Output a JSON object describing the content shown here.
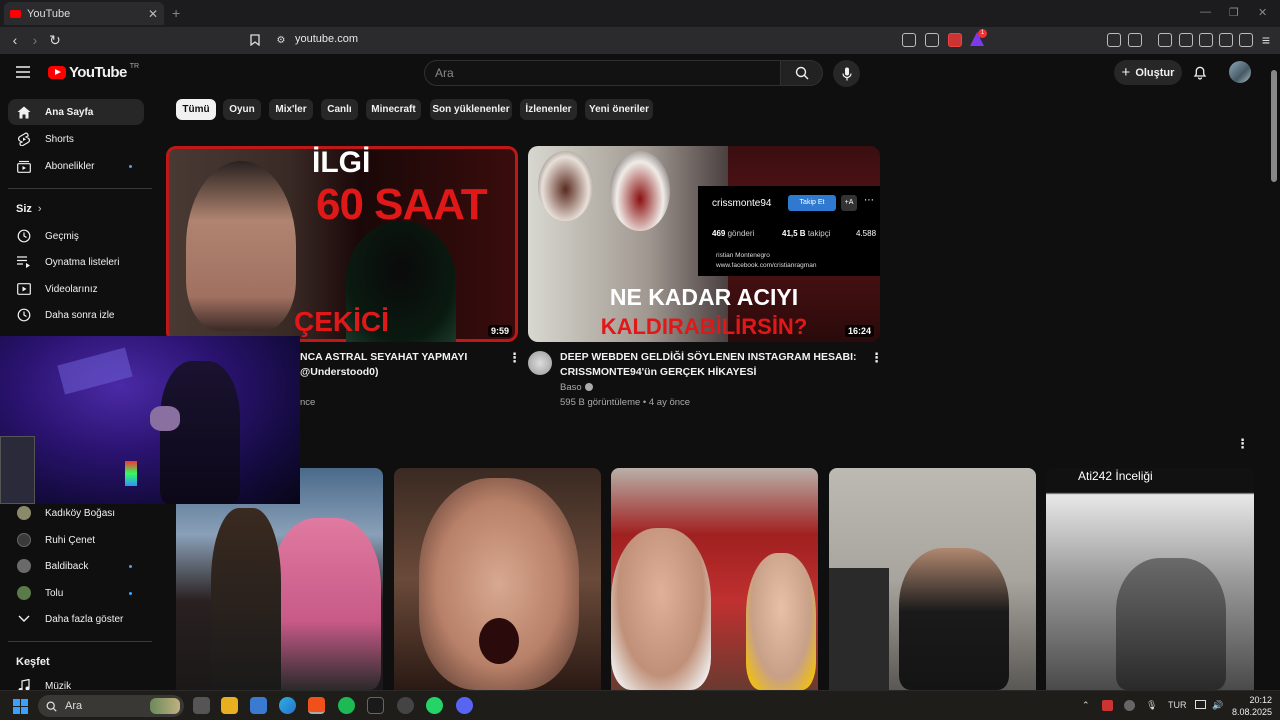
{
  "browser": {
    "tab_title": "YouTube",
    "tab_close": "✕",
    "new_tab": "+",
    "url": "youtube.com",
    "extension_badge": "1"
  },
  "header": {
    "logo_text": "YouTube",
    "logo_region": "TR",
    "search_placeholder": "Ara",
    "create_label": "Oluştur"
  },
  "sidebar": {
    "main": [
      {
        "label": "Ana Sayfa",
        "icon": "home-icon"
      },
      {
        "label": "Shorts",
        "icon": "shorts-icon"
      },
      {
        "label": "Abonelikler",
        "icon": "subscriptions-icon"
      }
    ],
    "you_heading": "Siz",
    "you_items": [
      {
        "label": "Geçmiş",
        "icon": "history-icon"
      },
      {
        "label": "Oynatma listeleri",
        "icon": "playlists-icon"
      },
      {
        "label": "Videolarınız",
        "icon": "your-videos-icon"
      },
      {
        "label": "Daha sonra izle",
        "icon": "watch-later-icon"
      }
    ],
    "subscriptions": [
      {
        "label": "Kadıköy Boğası",
        "color": "#8a8a6a"
      },
      {
        "label": "Ruhi Çenet",
        "color": "#3a3a3a"
      },
      {
        "label": "Baldiback",
        "color": "#6a6a6a"
      },
      {
        "label": "Tolu",
        "color": "#5a7a4a"
      }
    ],
    "show_more": "Daha fazla göster",
    "explore_heading": "Keşfet",
    "explore_items": [
      {
        "label": "Müzik",
        "icon": "music-icon"
      }
    ]
  },
  "chips": [
    "Tümü",
    "Oyun",
    "Mix'ler",
    "Canlı",
    "Minecraft",
    "Son yüklenenler",
    "İzlenenler",
    "Yeni öneriler"
  ],
  "videos": [
    {
      "title_line1": "NCA ASTRAL SEYAHAT YAPMAYI",
      "title_line2": "@Understood0)",
      "meta": "nce",
      "duration": "9:59",
      "thumb_text_1": "İLGİ",
      "thumb_text_2": "60 SAAT",
      "thumb_text_3": "ÇEKİCİ"
    },
    {
      "title_line1": "DEEP WEBDEN GELDİĞİ SÖYLENEN INSTAGRAM HESABI:",
      "title_line2": "CRISSMONTE94'ün GERÇEK HİKAYESİ",
      "channel": "Baso",
      "meta": "595 B görüntüleme • 4 ay önce",
      "duration": "16:24",
      "thumb_text_1": "NE KADAR ACIYI",
      "thumb_text_2": "KALDIRABİLİRSİN?",
      "ig_username": "crissmonte94",
      "ig_follow": "Takip Et",
      "ig_add": "+A",
      "ig_posts_num": "469",
      "ig_posts": "gönderi",
      "ig_followers_num": "41,5 B",
      "ig_followers": "takipçi",
      "ig_following": "4.588",
      "ig_bio_1": "ristian Montenegro",
      "ig_bio_2": "www.facebook.com/cristianragman"
    }
  ],
  "shorts": [
    {
      "text": "",
      "bg": "#c06a8a"
    },
    {
      "text": "",
      "bg": "#8a5a4a"
    },
    {
      "text": "",
      "bg": "#a08070"
    },
    {
      "text": "",
      "bg": "#6a6058"
    },
    {
      "text": "Ati242 İnceliği",
      "bg": "#888"
    }
  ],
  "taskbar": {
    "search_placeholder": "Ara",
    "lang": "TUR",
    "time": "20:12",
    "date": "8.08.2025"
  },
  "colors": {
    "accent": "#ff0000",
    "link": "#3ea6ff",
    "bg": "#0f0f0f"
  }
}
